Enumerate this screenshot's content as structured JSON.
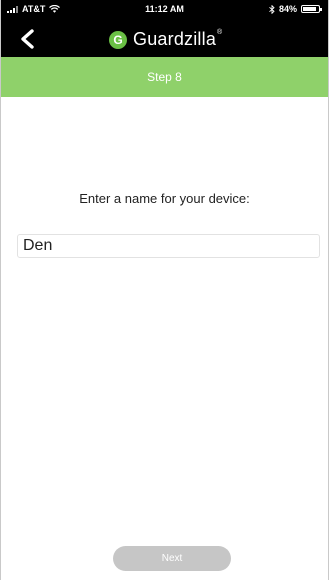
{
  "status_bar": {
    "carrier": "AT&T",
    "time": "11:12 AM",
    "battery_text": "84%",
    "battery_level": 0.84
  },
  "header": {
    "back_icon": "chevron-left-icon",
    "logo_letter": "G",
    "brand_name": "Guardzilla",
    "brand_mark": "®",
    "brand_color": "#6abf45"
  },
  "step": {
    "label": "Step 8",
    "color": "#8fd16a"
  },
  "form": {
    "prompt": "Enter a name for your device:",
    "device_name_value": "Den"
  },
  "actions": {
    "next_label": "Next",
    "next_color": "#c6c6c6"
  }
}
